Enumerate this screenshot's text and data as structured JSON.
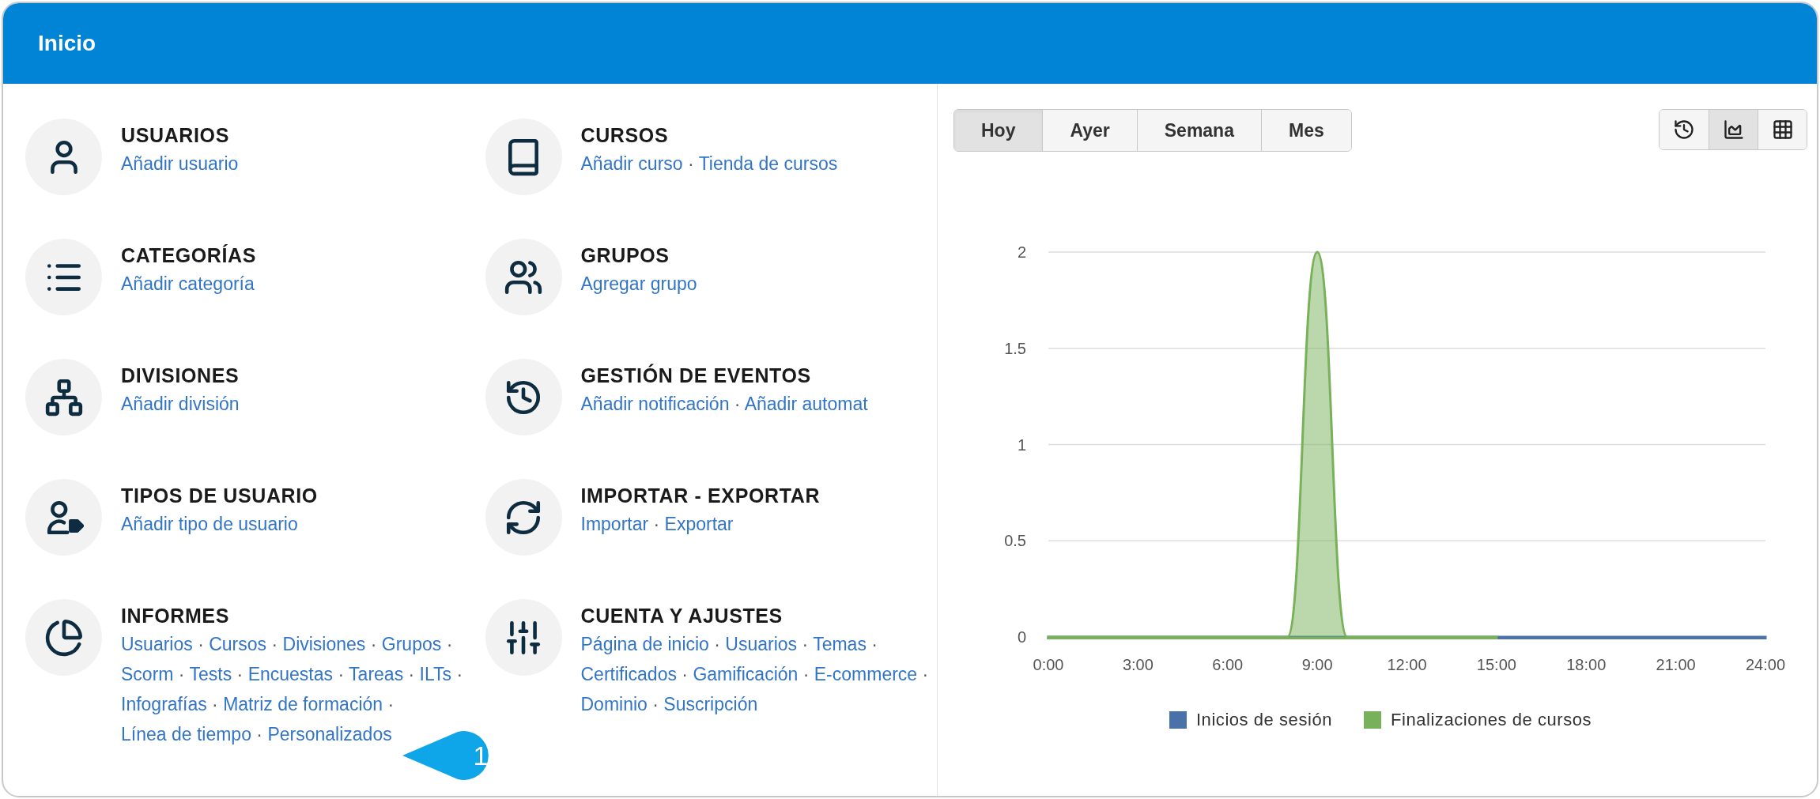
{
  "header": {
    "title": "Inicio"
  },
  "sections": [
    {
      "title": "USUARIOS",
      "links": [
        "Añadir usuario"
      ]
    },
    {
      "title": "CURSOS",
      "links": [
        "Añadir curso",
        "Tienda de cursos"
      ]
    },
    {
      "title": "CATEGORÍAS",
      "links": [
        "Añadir categoría"
      ]
    },
    {
      "title": "GRUPOS",
      "links": [
        "Agregar grupo"
      ]
    },
    {
      "title": "DIVISIONES",
      "links": [
        "Añadir división"
      ]
    },
    {
      "title": "GESTIÓN DE EVENTOS",
      "links": [
        "Añadir notificación",
        "Añadir automat"
      ]
    },
    {
      "title": "TIPOS DE USUARIO",
      "links": [
        "Añadir tipo de usuario"
      ]
    },
    {
      "title": "IMPORTAR - EXPORTAR",
      "links": [
        "Importar",
        "Exportar"
      ]
    },
    {
      "title": "INFORMES",
      "links": [
        "Usuarios",
        "Cursos",
        "Divisiones",
        "Grupos",
        "Scorm",
        "Tests",
        "Encuestas",
        "Tareas",
        "ILTs",
        "Infografías",
        "Matriz de formación",
        "Línea de tiempo",
        "Personalizados"
      ]
    },
    {
      "title": "CUENTA Y AJUSTES",
      "links": [
        "Página de inicio",
        "Usuarios",
        "Temas",
        "Certificados",
        "Gamificación",
        "E-commerce",
        "Dominio",
        "Suscripción"
      ]
    }
  ],
  "link_separator": "·",
  "callout": {
    "text": "1"
  },
  "period_tabs": [
    {
      "label": "Hoy",
      "selected": true
    },
    {
      "label": "Ayer",
      "selected": false
    },
    {
      "label": "Semana",
      "selected": false
    },
    {
      "label": "Mes",
      "selected": false
    }
  ],
  "view_buttons": [
    {
      "selected": false
    },
    {
      "selected": true
    },
    {
      "selected": false
    }
  ],
  "chart_data": {
    "type": "area",
    "x": [
      0,
      1,
      2,
      3,
      4,
      5,
      6,
      7,
      8,
      9,
      10,
      11,
      12,
      13,
      14,
      15,
      16,
      17,
      18,
      19,
      20,
      21,
      22,
      23,
      24
    ],
    "series": [
      {
        "name": "Inicios de sesión",
        "color": "#4a72a8",
        "values": [
          0,
          0,
          0,
          0,
          0,
          0,
          0,
          0,
          0,
          0,
          0,
          0,
          0,
          0,
          0,
          0,
          0,
          0,
          0,
          0,
          0,
          0,
          0,
          0,
          0
        ]
      },
      {
        "name": "Finalizaciones de cursos",
        "color": "#78b159",
        "values": [
          0,
          0,
          0,
          0,
          0,
          0,
          0,
          0,
          0,
          2,
          0,
          0,
          0,
          0,
          0,
          0,
          null,
          null,
          null,
          null,
          null,
          null,
          null,
          null,
          null
        ]
      }
    ],
    "xlim": [
      0,
      24
    ],
    "ylim": [
      0,
      2
    ],
    "grid": true,
    "legend": "bottom",
    "xticks": [
      {
        "value": 0,
        "label": "0:00"
      },
      {
        "value": 3,
        "label": "3:00"
      },
      {
        "value": 6,
        "label": "6:00"
      },
      {
        "value": 9,
        "label": "9:00"
      },
      {
        "value": 12,
        "label": "12:00"
      },
      {
        "value": 15,
        "label": "15:00"
      },
      {
        "value": 18,
        "label": "18:00"
      },
      {
        "value": 21,
        "label": "21:00"
      },
      {
        "value": 24,
        "label": "24:00"
      }
    ],
    "yticks": [
      0,
      0.5,
      1,
      1.5,
      2
    ]
  }
}
